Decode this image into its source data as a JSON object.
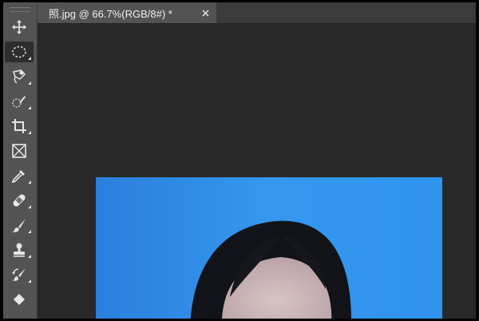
{
  "document": {
    "tab_title": "照.jpg @ 66.7%(RGB/8#) *"
  },
  "toolbar": {
    "tools": [
      {
        "name": "move-tool",
        "icon": "move-icon",
        "active": false
      },
      {
        "name": "elliptical-marquee-tool",
        "icon": "ellipse-marquee-icon",
        "active": true
      },
      {
        "name": "lasso-tool",
        "icon": "polygonal-lasso-icon",
        "active": false
      },
      {
        "name": "quick-selection-tool",
        "icon": "quick-selection-icon",
        "active": false
      },
      {
        "name": "crop-tool",
        "icon": "crop-icon",
        "active": false
      },
      {
        "name": "frame-tool",
        "icon": "frame-icon",
        "active": false
      },
      {
        "name": "eyedropper-tool",
        "icon": "eyedropper-icon",
        "active": false
      },
      {
        "name": "healing-brush-tool",
        "icon": "bandage-icon",
        "active": false
      },
      {
        "name": "brush-tool",
        "icon": "brush-icon",
        "active": false
      },
      {
        "name": "clone-stamp-tool",
        "icon": "stamp-icon",
        "active": false
      },
      {
        "name": "history-brush-tool",
        "icon": "history-brush-icon",
        "active": false
      },
      {
        "name": "eraser-tool",
        "icon": "eraser-icon",
        "active": false
      }
    ]
  },
  "colors": {
    "toolbar_bg": "#535353",
    "canvas_bg": "#282828",
    "photo_background": "#2f8fe8"
  }
}
